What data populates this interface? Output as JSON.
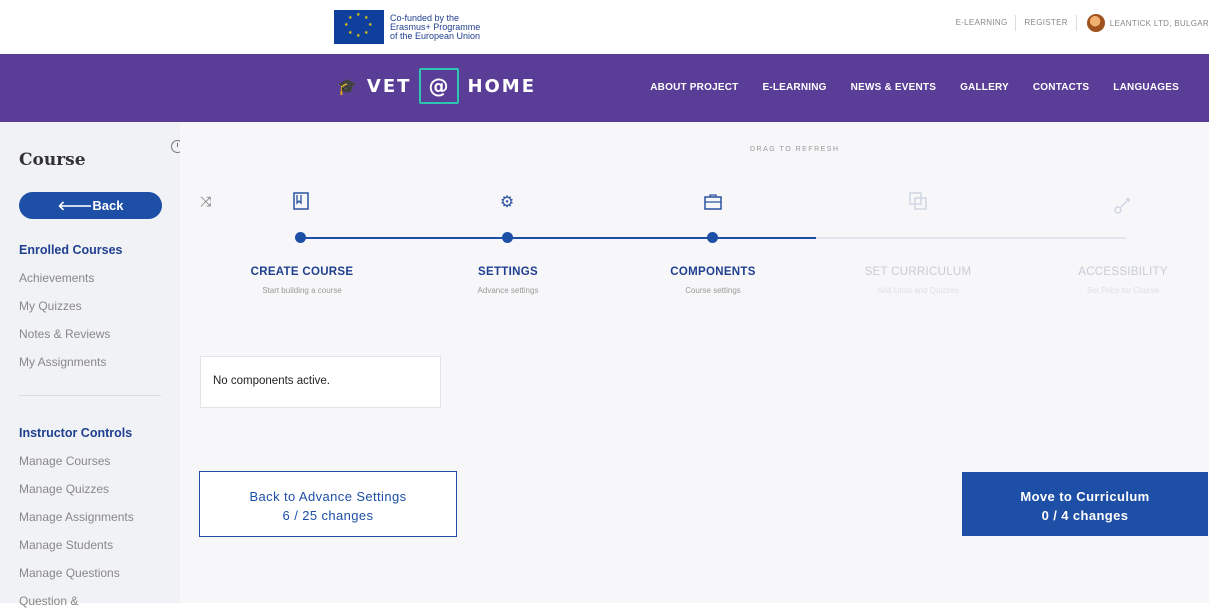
{
  "eu": {
    "line1": "Co-funded by the",
    "line2": "Erasmus+ Programme",
    "line3": "of the European Union"
  },
  "top_links": {
    "elearning": "E-LEARNING",
    "register": "REGISTER",
    "user": "LEANTICK LTD, BULGAR"
  },
  "brand": {
    "left": "VET",
    "at": "@",
    "right": "HOME"
  },
  "nav": [
    "ABOUT PROJECT",
    "E-LEARNING",
    "NEWS & EVENTS",
    "GALLERY",
    "CONTACTS",
    "LANGUAGES"
  ],
  "sidebar": {
    "title": "Course",
    "back": "🡐Back",
    "enrolled_head": "Enrolled Courses",
    "enrolled_items": [
      "Achievements",
      "My Quizzes",
      "Notes & Reviews",
      "My Assignments"
    ],
    "instructor_head": "Instructor Controls",
    "instructor_items": [
      "Manage Courses",
      "Manage Quizzes",
      "Manage Assignments",
      "Manage Students",
      "Manage Questions",
      "Question &"
    ]
  },
  "main": {
    "drag_refresh": "DRAG TO REFRESH",
    "steps": [
      {
        "label": "CREATE COURSE",
        "sub": "Start building a course",
        "icon": "bookmark-icon",
        "active": true
      },
      {
        "label": "SETTINGS",
        "sub": "Advance settings",
        "icon": "gear-icon",
        "active": true
      },
      {
        "label": "COMPONENTS",
        "sub": "Course settings",
        "icon": "briefcase-icon",
        "active": true
      },
      {
        "label": "SET CURRICULUM",
        "sub": "Add Units and Quizzes",
        "icon": "copy-icon",
        "active": false
      },
      {
        "label": "ACCESSIBILITY",
        "sub": "Set Price for Course",
        "icon": "key-icon",
        "active": false
      }
    ],
    "no_components": "No components active.",
    "back_btn": {
      "line1": "Back to Advance Settings",
      "line2": "6 / 25 changes"
    },
    "next_btn": {
      "line1": "Move to Curriculum",
      "line2": "0 / 4 changes"
    }
  },
  "colors": {
    "nav_bg": "#5a3d96",
    "primary": "#1d4fa6",
    "inactive": "#cfd5e2"
  }
}
